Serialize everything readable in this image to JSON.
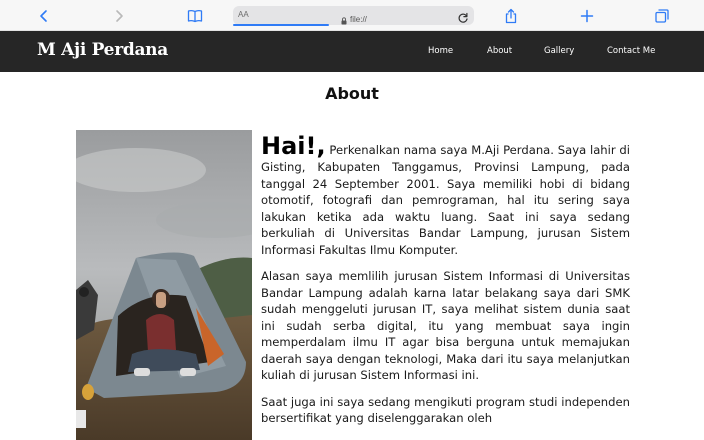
{
  "browser": {
    "reader_label": "AA",
    "url": "file://",
    "icons": [
      "back-chevron-icon",
      "forward-chevron-icon",
      "bookmarks-book-icon",
      "lock-icon",
      "reload-icon",
      "share-icon",
      "plus-icon",
      "tabs-icon"
    ]
  },
  "site": {
    "brand": "M Aji Perdana",
    "nav": [
      "Home",
      "About",
      "Gallery",
      "Contact Me"
    ]
  },
  "about": {
    "title": "About",
    "greeting": "Hai!,",
    "para1": "Perkenalkan nama saya M.Aji Perdana. Saya lahir di Gisting, Kabupaten Tanggamus, Provinsi Lampung, pada tanggal 24 September 2001. Saya memiliki hobi di bidang otomotif, fotografi dan pemrograman, hal itu sering saya lakukan ketika ada waktu luang. Saat ini saya sedang berkuliah di Universitas Bandar Lampung, jurusan Sistem Informasi Fakultas Ilmu Komputer.",
    "para2": "Alasan saya memlilih jurusan Sistem Informasi di Universitas Bandar Lampung adalah karna latar belakang saya dari SMK sudah menggeluti jurusan IT, saya melihat sistem dunia saat ini sudah serba digital, itu yang membuat saya ingin memperdalam ilmu IT agar bisa berguna untuk memajukan daerah saya dengan teknologi, Maka dari itu saya melanjutkan kuliah di jurusan Sistem Informasi ini.",
    "para3": "Saat juga ini saya sedang mengikuti program studi independen bersertifikat yang diselenggarakan oleh"
  },
  "colors": {
    "nav_bg": "#262626",
    "accent": "#2f7bf6",
    "page_bg": "#ffffff"
  }
}
